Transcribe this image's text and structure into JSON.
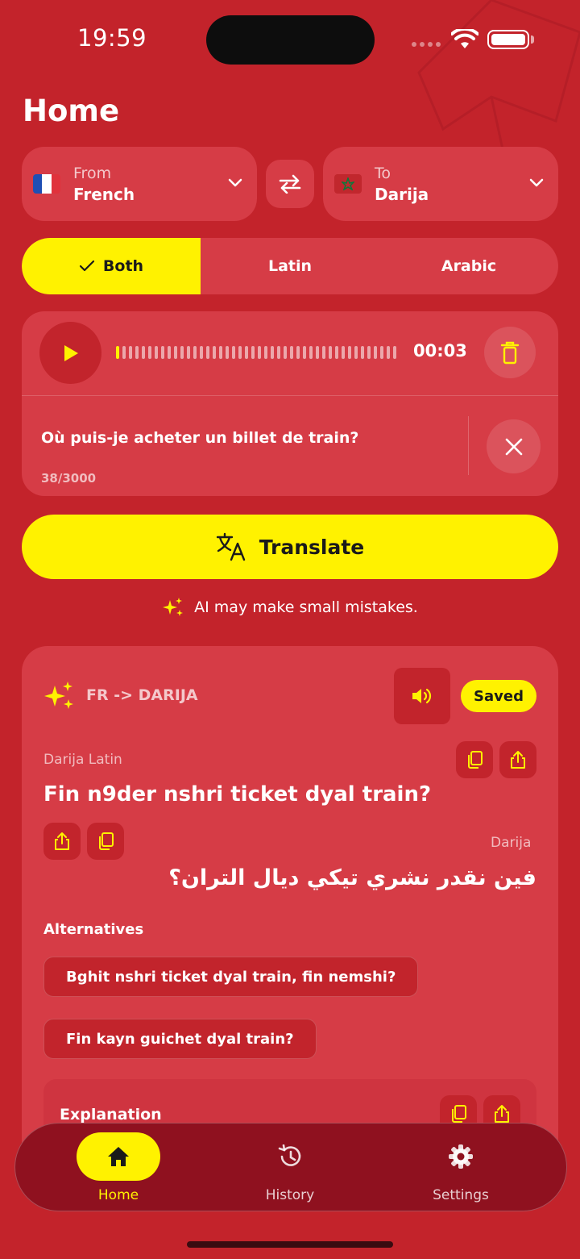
{
  "status": {
    "time": "19:59"
  },
  "page": {
    "title": "Home"
  },
  "languages": {
    "from": {
      "caption": "From",
      "name": "French",
      "flag": "france-flag"
    },
    "to": {
      "caption": "To",
      "name": "Darija",
      "flag": "morocco-flag"
    }
  },
  "script_mode": {
    "options": [
      "Both",
      "Latin",
      "Arabic"
    ],
    "selected": "Both"
  },
  "recording": {
    "duration": "00:03",
    "progress": 0.02
  },
  "input": {
    "text": "Où puis-je acheter un billet de train?",
    "count": "38/3000"
  },
  "translate": {
    "label": "Translate"
  },
  "notice": {
    "text": "AI may make small mistakes."
  },
  "result": {
    "pair": "FR -> DARIJA",
    "saved_label": "Saved",
    "latin_label": "Darija Latin",
    "latin_text": "Fin n9der nshri ticket dyal train?",
    "arabic_label": "Darija",
    "arabic_text": "فين نقدر نشري تيكي ديال التران؟",
    "alternatives_title": "Alternatives",
    "alternatives": [
      "Bghit nshri ticket dyal train, fin nemshi?",
      "Fin kayn guichet dyal train?"
    ],
    "explanation_title": "Explanation"
  },
  "nav": {
    "items": [
      {
        "label": "Home",
        "icon": "home-icon"
      },
      {
        "label": "History",
        "icon": "history-icon"
      },
      {
        "label": "Settings",
        "icon": "gear-icon"
      }
    ],
    "active": "Home"
  },
  "colors": {
    "background": "#c3232b",
    "card": "#d63c46",
    "accent": "#fff200",
    "nav": "#8f111f"
  }
}
